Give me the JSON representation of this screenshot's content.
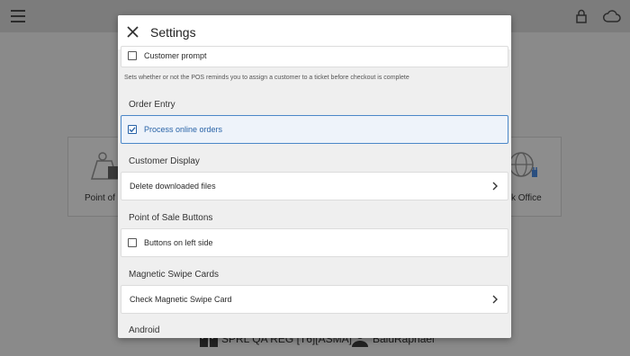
{
  "background": {
    "tiles": [
      {
        "label": "Point of S"
      },
      {
        "label": "ck Office"
      }
    ],
    "footer": {
      "store": "SPRL QA REG [T6][ASMA]",
      "user": "BaluRaphael"
    }
  },
  "dialog": {
    "title": "Settings",
    "rows": {
      "customer_prompt": "Customer prompt",
      "customer_prompt_hint": "Sets whether or not the POS reminds you to assign a customer to a ticket before checkout is complete",
      "process_online_orders": "Process online orders",
      "delete_downloaded_files": "Delete downloaded files",
      "buttons_on_left": "Buttons on left side",
      "check_magnetic_swipe": "Check Magnetic Swipe Card"
    },
    "sections": {
      "order_entry": "Order Entry",
      "customer_display": "Customer Display",
      "pos_buttons": "Point of Sale Buttons",
      "magnetic_swipe": "Magnetic Swipe Cards",
      "android": "Android"
    },
    "states": {
      "customer_prompt_checked": false,
      "process_online_orders_checked": true,
      "buttons_on_left_checked": false
    }
  },
  "colors": {
    "accent": "#2a64a8",
    "overlay": "#8a8a8a"
  },
  "icons": [
    "hamburger-menu-icon",
    "lock-icon",
    "cloud-icon",
    "close-icon",
    "checkbox-icon",
    "chevron-right-icon",
    "register-icon",
    "user-icon",
    "globe-plug-icon",
    "cash-register-icon"
  ]
}
